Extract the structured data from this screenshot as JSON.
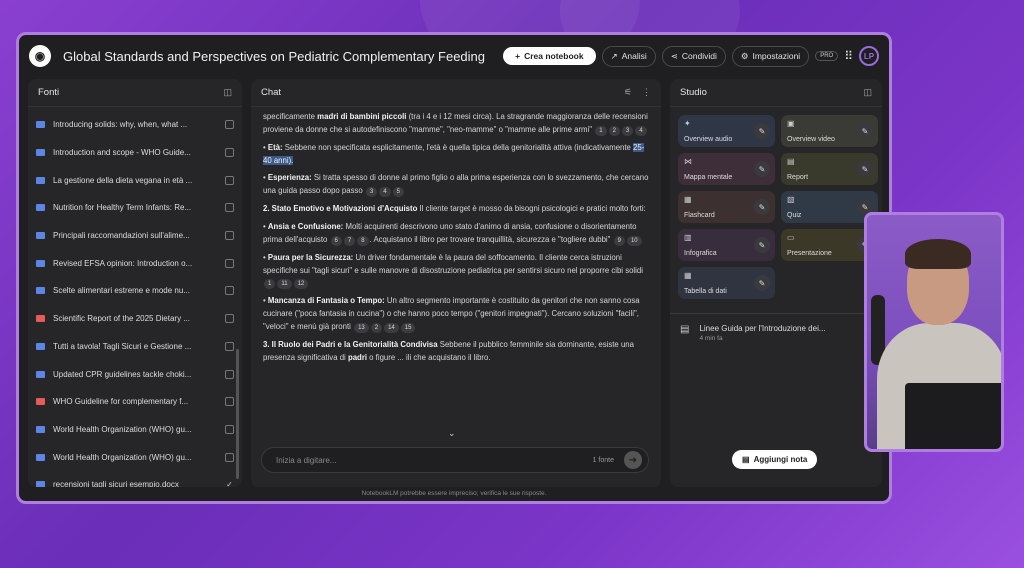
{
  "app": {
    "title": "Global Standards and Perspectives on Pediatric Complementary Feeding",
    "create_notebook": "Crea notebook",
    "analytics": "Analisi",
    "share": "Condividi",
    "settings": "Impostazioni",
    "pro": "PRO",
    "avatar_initials": "LP"
  },
  "sources": {
    "title": "Fonti",
    "items": [
      {
        "label": "Introducing solids: why, when, what ...",
        "icon": "blue",
        "checked": false
      },
      {
        "label": "Introduction and scope - WHO Guide...",
        "icon": "blue",
        "checked": false
      },
      {
        "label": "La gestione della dieta vegana in età ...",
        "icon": "blue",
        "checked": false
      },
      {
        "label": "Nutrition for Healthy Term Infants: Re...",
        "icon": "blue",
        "checked": false
      },
      {
        "label": "Principali raccomandazioni sull'alime...",
        "icon": "blue",
        "checked": false
      },
      {
        "label": "Revised EFSA opinion: Introduction o...",
        "icon": "blue",
        "checked": false
      },
      {
        "label": "Scelte alimentari estreme e mode nu...",
        "icon": "blue",
        "checked": false
      },
      {
        "label": "Scientific Report of the 2025 Dietary ...",
        "icon": "red",
        "checked": false
      },
      {
        "label": "Tutti a tavola! Tagli Sicuri e Gestione ...",
        "icon": "blue",
        "checked": false
      },
      {
        "label": "Updated CPR guidelines tackle choki...",
        "icon": "blue",
        "checked": false
      },
      {
        "label": "WHO Guideline for complementary f...",
        "icon": "red",
        "checked": false
      },
      {
        "label": "World Health Organization (WHO) gu...",
        "icon": "blue",
        "checked": false
      },
      {
        "label": "World Health Organization (WHO) gu...",
        "icon": "blue",
        "checked": false
      },
      {
        "label": "recensioni tagli sicuri esempio.docx",
        "icon": "blue",
        "checked": true
      }
    ]
  },
  "chat": {
    "title": "Chat",
    "p1_a": "specificamente ",
    "p1_b": "madri di bambini piccoli",
    "p1_c": " (tra i 4 e i 12 mesi circa). La stragrande maggioranza delle recensioni proviene da donne che si autodefiniscono \"mamme\", \"neo-mamme\" o \"mamme alle prime armi\"",
    "p2_label": "Età:",
    "p2_text": " Sebbene non specificata esplicitamente, l'età è quella tipica della genitorialità attiva (indicativamente ",
    "p2_hl": "25-40 anni).",
    "p3_label": "Esperienza:",
    "p3_text": " Si tratta spesso di donne al primo figlio o alla prima esperienza con lo svezzamento, che cercano una guida passo dopo passo",
    "h2": "2. Stato Emotivo e Motivazioni d'Acquisto",
    "h2_text": " Il cliente target è mosso da bisogni psicologici e pratici molto forti:",
    "p4_label": "Ansia e Confusione:",
    "p4_text": " Molti acquirenti descrivono uno stato d'animo di ansia, confusione o disorientamento prima dell'acquisto",
    "p4_text2": ". Acquistano il libro per trovare tranquillità, sicurezza e \"togliere dubbi\"",
    "p5_label": "Paura per la Sicurezza:",
    "p5_text": " Un driver fondamentale è la paura del soffocamento. Il cliente cerca istruzioni specifiche sui \"tagli sicuri\" e sulle manovre di disostruzione pediatrica per sentirsi sicuro nel proporre cibi solidi",
    "p6_label": "Mancanza di Fantasia o Tempo:",
    "p6_text": " Un altro segmento importante è costituito da genitori che non sanno cosa cucinare (\"poca fantasia in cucina\") o che hanno poco tempo (\"genitori impegnati\"). Cercano soluzioni \"facili\", \"veloci\" e menù già pronti",
    "h3": "3. Il Ruolo dei Padri e la Genitorialità Condivisa",
    "h3_text": " Sebbene il pubblico femminile sia dominante, esiste una presenza significativa di ",
    "h3_b": "padri",
    "h3_text2": " o figure ... ili che acquistano il libro.",
    "cites_p1": [
      "1",
      "2",
      "3",
      "4"
    ],
    "cites_p3": [
      "3",
      "4",
      "5"
    ],
    "cites_p4a": [
      "6",
      "7",
      "8"
    ],
    "cites_p4b": [
      "9",
      "10"
    ],
    "cites_p5": [
      "1",
      "11",
      "12"
    ],
    "cites_p6": [
      "13",
      "2",
      "14",
      "15"
    ],
    "input_placeholder": "Inizia a digitare...",
    "source_count": "1 fonte"
  },
  "studio": {
    "title": "Studio",
    "tiles": [
      {
        "label": "Overview audio",
        "icon": "✦"
      },
      {
        "label": "Overview video",
        "icon": "▣"
      },
      {
        "label": "Mappa mentale",
        "icon": "⋈"
      },
      {
        "label": "Report",
        "icon": "▤"
      },
      {
        "label": "Flashcard",
        "icon": "▦"
      },
      {
        "label": "Quiz",
        "icon": "▧"
      },
      {
        "label": "Infografica",
        "icon": "▥"
      },
      {
        "label": "Presentazione",
        "icon": "▭"
      },
      {
        "label": "Tabella di dati",
        "icon": "▦"
      }
    ],
    "note_title": "Linee Guida per l'Introduzione dei...",
    "note_time": "4 min fa",
    "add_note": "Aggiungi nota"
  },
  "footer": "NotebookLM potrebbe essere impreciso; verifica le sue risposte."
}
